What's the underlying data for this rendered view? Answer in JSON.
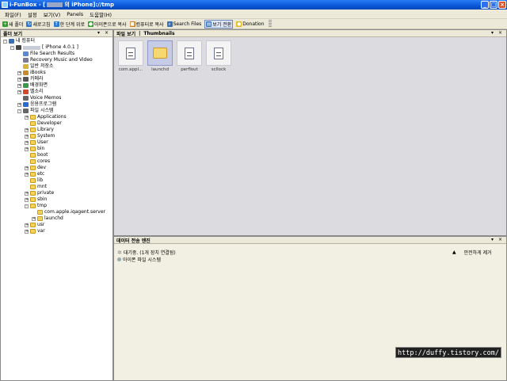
{
  "window": {
    "title_prefix": "i-FunBox - [",
    "title_suffix": "의 iPhone]://tmp",
    "controls": [
      "_",
      "□",
      "×"
    ]
  },
  "menu": [
    "파일(F)",
    "설정",
    "보기(V)",
    "Panels",
    "도움말(H)"
  ],
  "toolbar": [
    {
      "label": "새 폴더",
      "icon": "plus-icon",
      "color": "#2aa02a"
    },
    {
      "label": "새로고침",
      "icon": "refresh-icon",
      "color": "#2a7bd0"
    },
    {
      "label": "한 단계 위로",
      "icon": "up-arrow-icon",
      "color": "#2a7bd0"
    },
    {
      "label": "아이폰으로 복사",
      "icon": "copy-to-iphone-icon",
      "color": "#2aa02a"
    },
    {
      "label": "컴퓨터로 복사",
      "icon": "copy-to-pc-icon",
      "color": "#d07a1a"
    },
    {
      "label": "Search Files",
      "icon": "search-icon",
      "color": "#3b6fb3"
    },
    {
      "label": "보기 전환",
      "icon": "view-toggle-icon",
      "color": "#3b6fb3"
    },
    {
      "label": "Donation",
      "icon": "donation-icon",
      "color": "#e0b91a"
    }
  ],
  "folder_panel": {
    "title": "폴더 보기",
    "controls": "▾ ×"
  },
  "file_panel": {
    "title": "파일 보기",
    "separator": "|",
    "view": "Thumbnails",
    "controls": "▾ ×"
  },
  "transfer_panel": {
    "title": "데이터 전송 엔진",
    "controls": "▾ ×",
    "rows": [
      {
        "text": "대기중. (1개 장치 연결됨)",
        "icon": "gear-icon"
      },
      {
        "text": "아이폰 파일 시스템",
        "icon": "device-icon"
      }
    ],
    "safe_remove": "안전하게 제거"
  },
  "tree": [
    {
      "label": "내 컴퓨터",
      "depth": 0,
      "expander": "-",
      "icon": "computer-icon",
      "color": "#3b6fb3"
    },
    {
      "label": "[ iPhone 4.0.1 ]",
      "depth": 1,
      "expander": "-",
      "icon": "iphone-icon",
      "color": "#444",
      "redacted": true
    },
    {
      "label": "File Search Results",
      "depth": 2,
      "icon": "search-results-icon",
      "color": "#5a8ad1"
    },
    {
      "label": "Recovery Music and Video",
      "depth": 2,
      "icon": "music-icon",
      "color": "#7a7a9a"
    },
    {
      "label": "일반 저장소",
      "depth": 2,
      "icon": "storage-icon",
      "color": "#d8b23a"
    },
    {
      "label": "iBooks",
      "depth": 2,
      "expander": "+",
      "icon": "ibooks-icon",
      "color": "#c98a2a"
    },
    {
      "label": "카메라",
      "depth": 2,
      "expander": "+",
      "icon": "camera-icon",
      "color": "#555"
    },
    {
      "label": "배경화면",
      "depth": 2,
      "expander": "+",
      "icon": "wallpaper-icon",
      "color": "#3a9a4a"
    },
    {
      "label": "벨소리",
      "depth": 2,
      "expander": "+",
      "icon": "ringtone-icon",
      "color": "#d24a2a"
    },
    {
      "label": "Voice Memos",
      "depth": 2,
      "icon": "voice-memos-icon",
      "color": "#666"
    },
    {
      "label": "응용프로그램",
      "depth": 2,
      "expander": "+",
      "icon": "apps-icon",
      "color": "#2a6ad0"
    },
    {
      "label": "파일 시스템",
      "depth": 2,
      "expander": "-",
      "icon": "filesystem-icon",
      "color": "#666"
    },
    {
      "label": "Applications",
      "depth": 3,
      "expander": "+",
      "icon": "folder-icon"
    },
    {
      "label": "Developer",
      "depth": 3,
      "icon": "folder-icon"
    },
    {
      "label": "Library",
      "depth": 3,
      "expander": "+",
      "icon": "folder-icon"
    },
    {
      "label": "System",
      "depth": 3,
      "expander": "+",
      "icon": "folder-icon"
    },
    {
      "label": "User",
      "depth": 3,
      "expander": "+",
      "icon": "folder-icon"
    },
    {
      "label": "bin",
      "depth": 3,
      "expander": "+",
      "icon": "folder-icon"
    },
    {
      "label": "boot",
      "depth": 3,
      "icon": "folder-icon"
    },
    {
      "label": "cores",
      "depth": 3,
      "icon": "folder-icon"
    },
    {
      "label": "dev",
      "depth": 3,
      "expander": "+",
      "icon": "folder-icon"
    },
    {
      "label": "etc",
      "depth": 3,
      "expander": "+",
      "icon": "folder-icon"
    },
    {
      "label": "lib",
      "depth": 3,
      "icon": "folder-icon"
    },
    {
      "label": "mnt",
      "depth": 3,
      "icon": "folder-icon"
    },
    {
      "label": "private",
      "depth": 3,
      "expander": "+",
      "icon": "folder-icon"
    },
    {
      "label": "sbin",
      "depth": 3,
      "expander": "+",
      "icon": "folder-icon"
    },
    {
      "label": "tmp",
      "depth": 3,
      "expander": "-",
      "icon": "folder-icon"
    },
    {
      "label": "com.apple.iqagent.server",
      "depth": 4,
      "icon": "folder-icon"
    },
    {
      "label": "launchd",
      "depth": 4,
      "expander": "+",
      "icon": "folder-icon"
    },
    {
      "label": "usr",
      "depth": 3,
      "expander": "+",
      "icon": "folder-icon"
    },
    {
      "label": "var",
      "depth": 3,
      "expander": "+",
      "icon": "folder-icon"
    }
  ],
  "thumbnails": [
    {
      "label": "com.appl...",
      "type": "doc",
      "selected": false
    },
    {
      "label": "launchd",
      "type": "folder",
      "selected": true
    },
    {
      "label": "perflout",
      "type": "doc",
      "selected": false
    },
    {
      "label": "scllock",
      "type": "doc",
      "selected": false
    }
  ],
  "watermark": "http://duffy.tistory.com/"
}
